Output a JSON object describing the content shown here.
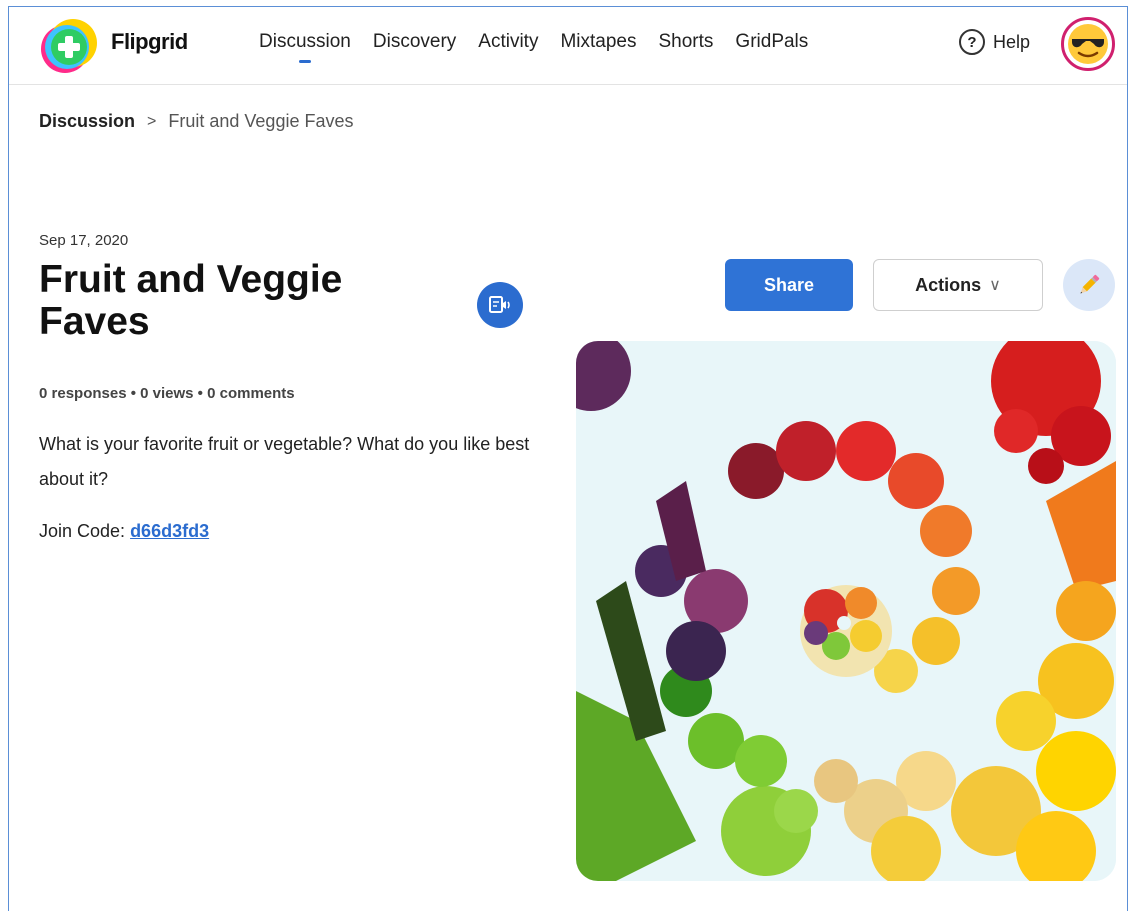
{
  "header": {
    "brand": "Flipgrid",
    "nav": [
      {
        "label": "Discussion",
        "active": true
      },
      {
        "label": "Discovery",
        "active": false
      },
      {
        "label": "Activity",
        "active": false
      },
      {
        "label": "Mixtapes",
        "active": false
      },
      {
        "label": "Shorts",
        "active": false
      },
      {
        "label": "GridPals",
        "active": false
      }
    ],
    "help_icon": "?",
    "help_label": "Help",
    "avatar_icon": "sunglasses-emoji-icon"
  },
  "breadcrumb": {
    "root": "Discussion",
    "separator": ">",
    "current": "Fruit and Veggie Faves"
  },
  "topic": {
    "date": "Sep 17, 2020",
    "title": "Fruit and Veggie Faves",
    "stats": "0 responses • 0 views • 0 comments",
    "prompt": "What is your favorite fruit or vegetable? What do you like best about it?",
    "join_code_label": "Join Code: ",
    "join_code": "d66d3fd3"
  },
  "actions": {
    "share_label": "Share",
    "actions_label": "Actions",
    "chevron": "∨"
  },
  "colors": {
    "accent": "#2b6ccf",
    "share_bg": "#2f73d6",
    "avatar_ring": "#d0206e",
    "edit_bg": "#dbe7f8"
  }
}
